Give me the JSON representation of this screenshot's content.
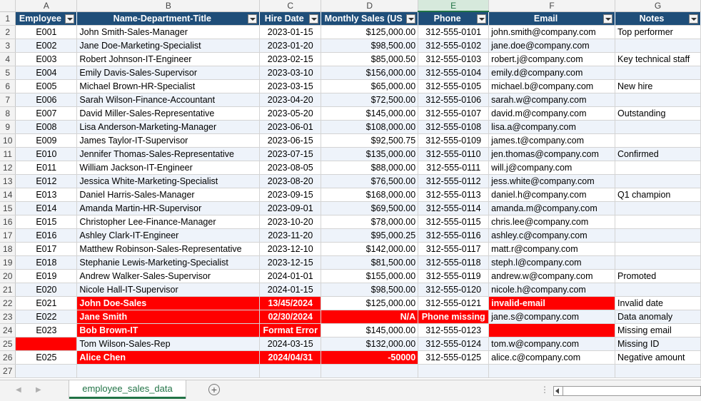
{
  "sheet": {
    "columns": [
      "A",
      "B",
      "C",
      "D",
      "E",
      "F",
      "G"
    ],
    "selected_column": "E",
    "header_row": [
      "Employee",
      "Name-Department-Title",
      "Hire Date",
      "Monthly Sales (US",
      "Phone",
      "Email",
      "Notes"
    ],
    "rows": [
      {
        "num": "1"
      },
      {
        "num": "2",
        "cells": [
          "E001",
          "John Smith-Sales-Manager",
          "2023-01-15",
          "$125,000.00",
          "312-555-0101",
          "john.smith@company.com",
          "Top performer"
        ]
      },
      {
        "num": "3",
        "cells": [
          "E002",
          "Jane Doe-Marketing-Specialist",
          "2023-01-20",
          "$98,500.00",
          "312-555-0102",
          "jane.doe@company.com",
          ""
        ]
      },
      {
        "num": "4",
        "cells": [
          "E003",
          "Robert Johnson-IT-Engineer",
          "2023-02-15",
          "$85,000.50",
          "312-555-0103",
          "robert.j@company.com",
          "Key technical staff"
        ]
      },
      {
        "num": "5",
        "cells": [
          "E004",
          "Emily Davis-Sales-Supervisor",
          "2023-03-10",
          "$156,000.00",
          "312-555-0104",
          "emily.d@company.com",
          ""
        ]
      },
      {
        "num": "6",
        "cells": [
          "E005",
          "Michael Brown-HR-Specialist",
          "2023-03-15",
          "$65,000.00",
          "312-555-0105",
          "michael.b@company.com",
          "New hire"
        ]
      },
      {
        "num": "7",
        "cells": [
          "E006",
          "Sarah Wilson-Finance-Accountant",
          "2023-04-20",
          "$72,500.00",
          "312-555-0106",
          "sarah.w@company.com",
          ""
        ]
      },
      {
        "num": "8",
        "cells": [
          "E007",
          "David Miller-Sales-Representative",
          "2023-05-20",
          "$145,000.00",
          "312-555-0107",
          "david.m@company.com",
          "Outstanding"
        ]
      },
      {
        "num": "9",
        "cells": [
          "E008",
          "Lisa Anderson-Marketing-Manager",
          "2023-06-01",
          "$108,000.00",
          "312-555-0108",
          "lisa.a@company.com",
          ""
        ]
      },
      {
        "num": "10",
        "cells": [
          "E009",
          "James Taylor-IT-Supervisor",
          "2023-06-15",
          "$92,500.75",
          "312-555-0109",
          "james.t@company.com",
          ""
        ]
      },
      {
        "num": "11",
        "cells": [
          "E010",
          "Jennifer Thomas-Sales-Representative",
          "2023-07-15",
          "$135,000.00",
          "312-555-0110",
          "jen.thomas@company.com",
          "Confirmed"
        ]
      },
      {
        "num": "12",
        "cells": [
          "E011",
          "William Jackson-IT-Engineer",
          "2023-08-05",
          "$88,000.00",
          "312-555-0111",
          "will.j@company.com",
          ""
        ]
      },
      {
        "num": "13",
        "cells": [
          "E012",
          "Jessica White-Marketing-Specialist",
          "2023-08-20",
          "$76,500.00",
          "312-555-0112",
          "jess.white@company.com",
          ""
        ]
      },
      {
        "num": "14",
        "cells": [
          "E013",
          "Daniel Harris-Sales-Manager",
          "2023-09-15",
          "$168,000.00",
          "312-555-0113",
          "daniel.h@company.com",
          "Q1 champion"
        ]
      },
      {
        "num": "15",
        "cells": [
          "E014",
          "Amanda Martin-HR-Supervisor",
          "2023-09-01",
          "$69,500.00",
          "312-555-0114",
          "amanda.m@company.com",
          ""
        ]
      },
      {
        "num": "16",
        "cells": [
          "E015",
          "Christopher Lee-Finance-Manager",
          "2023-10-20",
          "$78,000.00",
          "312-555-0115",
          "chris.lee@company.com",
          ""
        ]
      },
      {
        "num": "17",
        "cells": [
          "E016",
          "Ashley Clark-IT-Engineer",
          "2023-11-20",
          "$95,000.25",
          "312-555-0116",
          "ashley.c@company.com",
          ""
        ]
      },
      {
        "num": "18",
        "cells": [
          "E017",
          "Matthew Robinson-Sales-Representative",
          "2023-12-10",
          "$142,000.00",
          "312-555-0117",
          "matt.r@company.com",
          ""
        ]
      },
      {
        "num": "19",
        "cells": [
          "E018",
          "Stephanie Lewis-Marketing-Specialist",
          "2023-12-15",
          "$81,500.00",
          "312-555-0118",
          "steph.l@company.com",
          ""
        ]
      },
      {
        "num": "20",
        "cells": [
          "E019",
          "Andrew Walker-Sales-Supervisor",
          "2024-01-01",
          "$155,000.00",
          "312-555-0119",
          "andrew.w@company.com",
          "Promoted"
        ]
      },
      {
        "num": "21",
        "cells": [
          "E020",
          "Nicole Hall-IT-Supervisor",
          "2024-01-15",
          "$98,500.00",
          "312-555-0120",
          "nicole.h@company.com",
          ""
        ]
      },
      {
        "num": "22",
        "cells": [
          "E021",
          "John Doe-Sales",
          "13/45/2024",
          "$125,000.00",
          "312-555-0121",
          "invalid-email",
          "Invalid date"
        ]
      },
      {
        "num": "23",
        "cells": [
          "E022",
          "Jane Smith",
          "02/30/2024",
          "N/A",
          "Phone missing",
          "jane.s@company.com",
          "Data anomaly"
        ]
      },
      {
        "num": "24",
        "cells": [
          "E023",
          "Bob Brown-IT",
          "Format Error",
          "$145,000.00",
          "312-555-0123",
          "",
          "Missing email"
        ]
      },
      {
        "num": "25",
        "cells": [
          "",
          "Tom Wilson-Sales-Rep",
          "2024-03-15",
          "$132,000.00",
          "312-555-0124",
          "tom.w@company.com",
          "Missing ID"
        ]
      },
      {
        "num": "26",
        "cells": [
          "E025",
          "Alice Chen",
          "2024/04/31",
          "-50000",
          "312-555-0125",
          "alice.c@company.com",
          "Negative amount"
        ]
      },
      {
        "num": "27",
        "cells": [
          "",
          "",
          "",
          "",
          "",
          "",
          ""
        ]
      }
    ]
  },
  "colors": {
    "header_fill": "#1f4e79",
    "band_fill": "#eef3fa",
    "error_fill": "#ff0000",
    "accent": "#217346"
  },
  "footer": {
    "sheet_tab": "employee_sales_data",
    "add_sheet_icon": "plus-circle-icon",
    "scroll_left_icon": "triangle-left-icon",
    "scroll_right_icon": "triangle-right-icon"
  }
}
